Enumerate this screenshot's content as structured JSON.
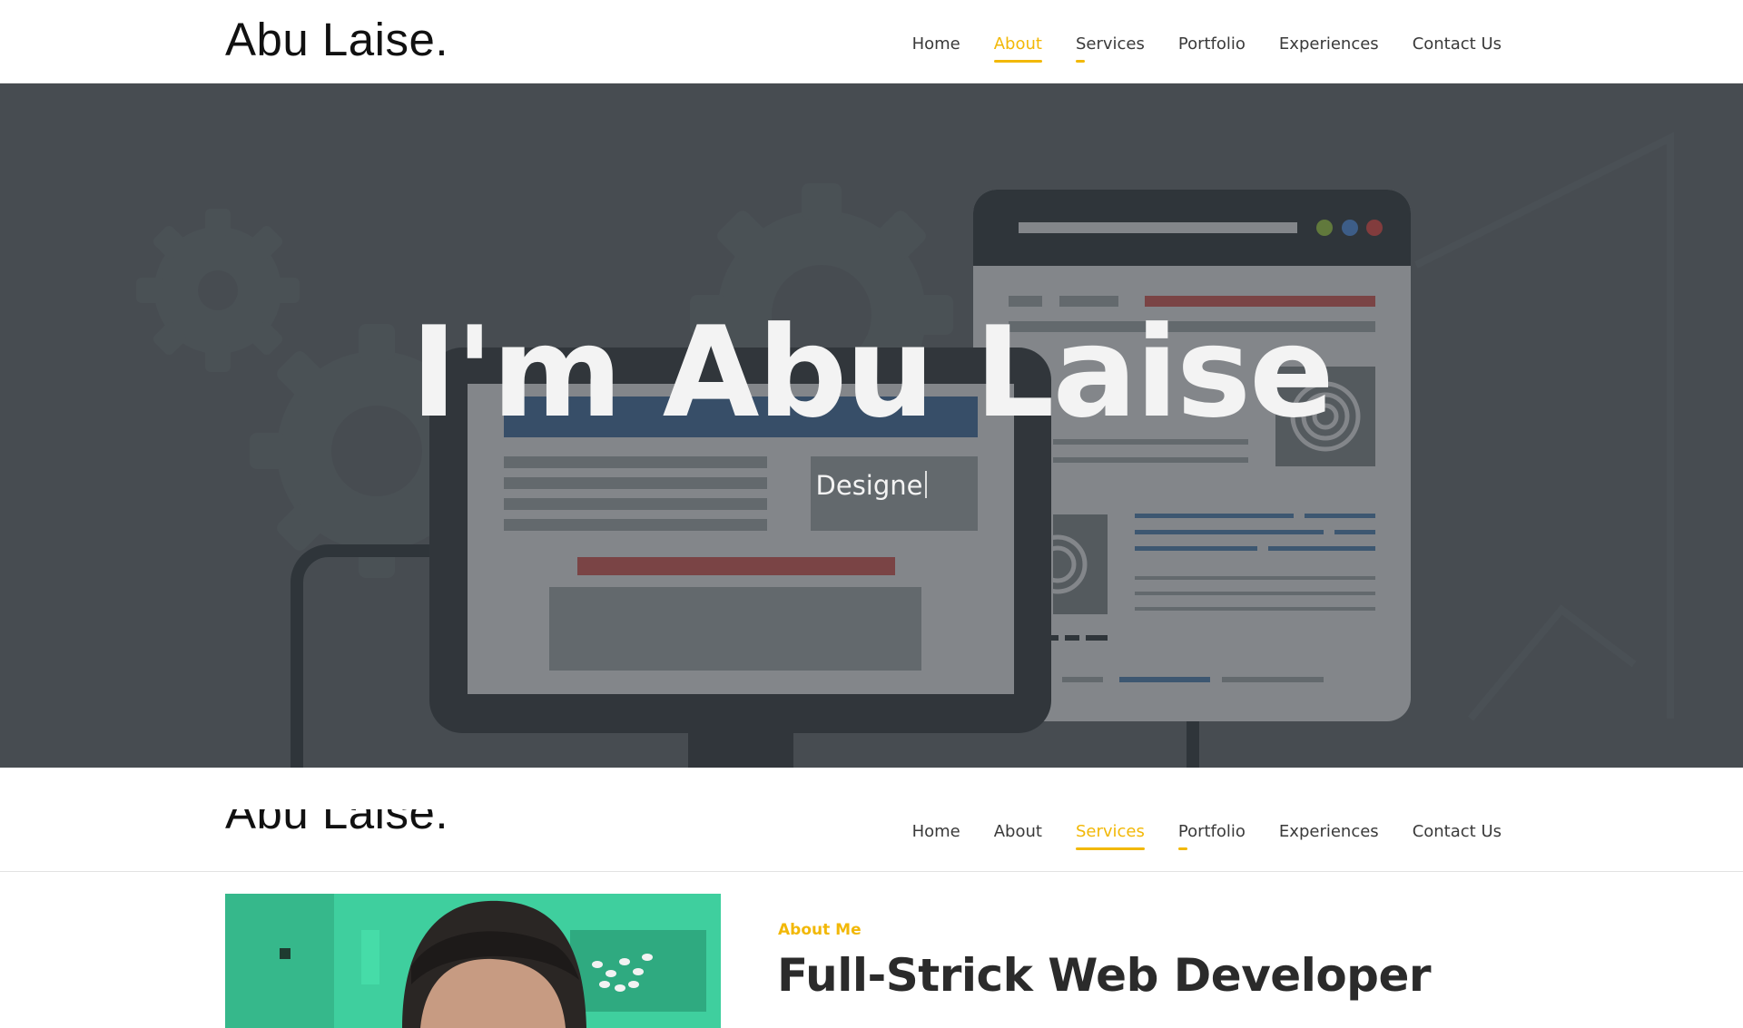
{
  "brand": {
    "logo_text": "Abu Laise.",
    "accent_color": "#f2b807"
  },
  "nav_top": {
    "items": [
      {
        "label": "Home",
        "active": false
      },
      {
        "label": "About",
        "active": true
      },
      {
        "label": "Services",
        "active": false
      },
      {
        "label": "Portfolio",
        "active": false
      },
      {
        "label": "Experiences",
        "active": false
      },
      {
        "label": "Contact Us",
        "active": false
      }
    ]
  },
  "hero": {
    "title": "I'm Abu Laise",
    "typed_text": "Designe",
    "background_illustration": "web-design-monitor-browser-gears",
    "overlay_color": "#50565a"
  },
  "nav_sticky": {
    "logo_text": "Abu Laise.",
    "items": [
      {
        "label": "Home",
        "active": false
      },
      {
        "label": "About",
        "active": false
      },
      {
        "label": "Services",
        "active": true
      },
      {
        "label": "Portfolio",
        "active": false
      },
      {
        "label": "Experiences",
        "active": false
      },
      {
        "label": "Contact Us",
        "active": false
      }
    ]
  },
  "about": {
    "kicker": "About Me",
    "heading": "Full-Strick Web Developer",
    "photo": "profile-photo"
  }
}
